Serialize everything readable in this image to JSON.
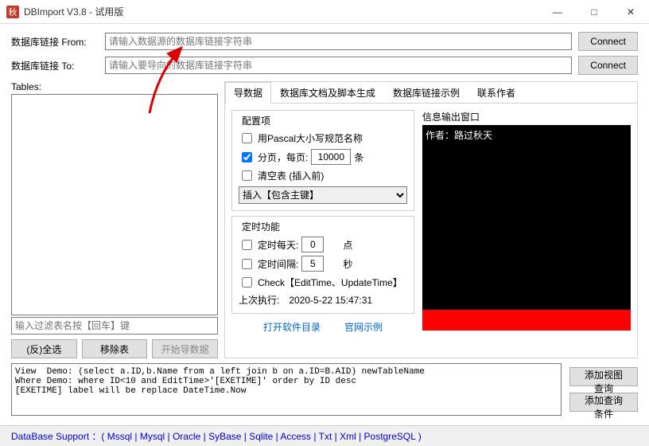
{
  "window": {
    "icon_char": "秋",
    "title": "DBImport V3.8 - 试用版"
  },
  "win_btns": {
    "min": "—",
    "max": "□",
    "close": "✕"
  },
  "conn": {
    "from_label": "数据库链接 From:",
    "from_placeholder": "请输入数据源的数据库链接字符串",
    "from_value": "",
    "to_label": "数据库链接 To:",
    "to_placeholder": "请输入要导向的数据库链接字符串",
    "to_value": "",
    "connect_btn": "Connect"
  },
  "tables": {
    "label": "Tables:",
    "filter_placeholder": "输入过滤表名按【回车】键",
    "select_all": "(反)全选",
    "remove": "移除表",
    "start": "开始导数据"
  },
  "tabs": {
    "t1": "导数据",
    "t2": "数据库文档及脚本生成",
    "t3": "数据库链接示例",
    "t4": "联系作者"
  },
  "cfg": {
    "title": "配置项",
    "pascal": "用Pascal大小写规范名称",
    "paging_label": "分页，每页:",
    "paging_value": "10000",
    "paging_suffix": "条",
    "truncate": "清空表 (插入前)",
    "insert_select": "插入【包含主键】",
    "timer_title": "定时功能",
    "daily": "定时每天:",
    "daily_value": "0",
    "daily_suffix": "点",
    "interval": "定时间隔:",
    "interval_value": "5",
    "interval_suffix": "秒",
    "check_time": "Check【EditTime、UpdateTime】",
    "last_run_label": "上次执行:",
    "last_run_value": "2020-5-22 15:47:31"
  },
  "info": {
    "title": "信息输出窗口",
    "author": "作者：路过秋天"
  },
  "links": {
    "open_dir": "打开软件目录",
    "official": "官网示例"
  },
  "demo": "View  Demo: (select a.ID,b.Name from a left join b on a.ID=B.AID) newTableName\nWhere Demo: where ID<10 and EditTime>'[EXETIME]' order by ID desc\n[EXETIME] label will be replace DateTime.Now",
  "side": {
    "add_view": "添加视图查询",
    "add_cond": "添加查询条件"
  },
  "footer": "DataBase Support ：( Mssql | Mysql | Oracle | SyBase | Sqlite | Access | Txt | Xml | PostgreSQL )"
}
